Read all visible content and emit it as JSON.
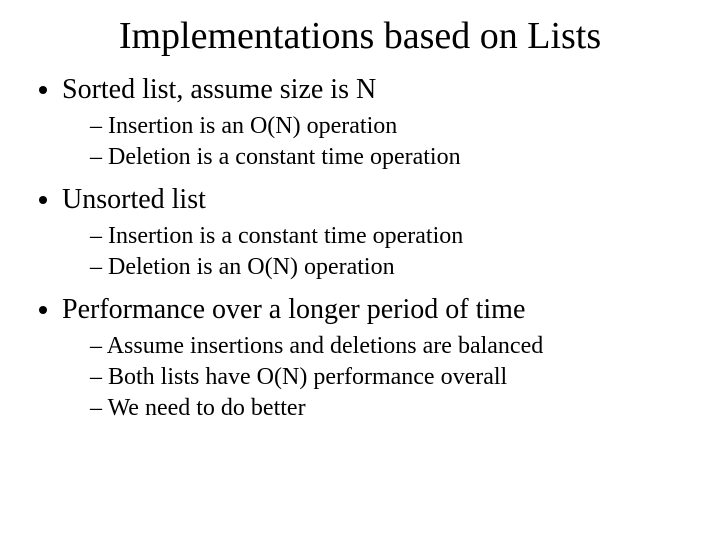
{
  "title": "Implementations based on Lists",
  "bullets": [
    {
      "text": "Sorted list, assume size is N",
      "sub": [
        "Insertion is an O(N) operation",
        "Deletion is a constant time operation"
      ]
    },
    {
      "text": "Unsorted list",
      "sub": [
        "Insertion is a constant time operation",
        "Deletion is an O(N) operation"
      ]
    },
    {
      "text": "Performance over a longer period of time",
      "sub": [
        "Assume insertions and deletions are balanced",
        "Both lists have O(N) performance overall",
        "We need to do better"
      ]
    }
  ]
}
